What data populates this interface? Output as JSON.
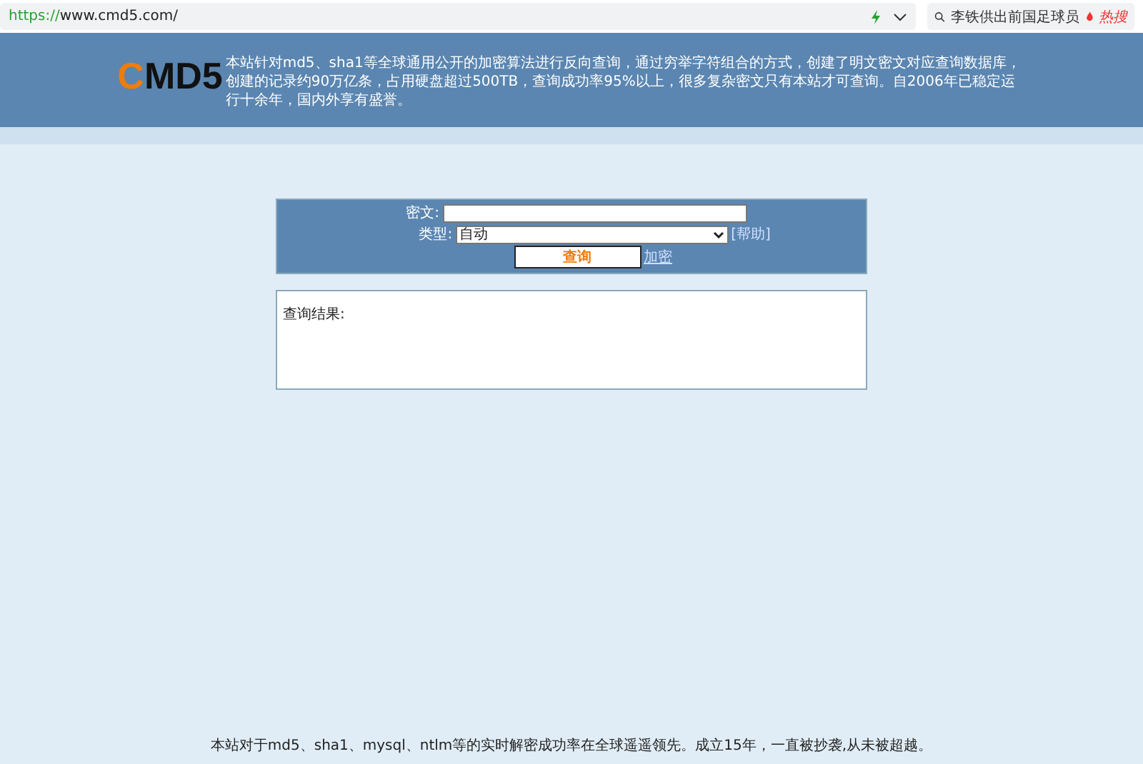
{
  "address_bar": {
    "scheme": "https://",
    "url": "www.cmd5.com/"
  },
  "hot_search": {
    "query": "李铁供出前国足球员",
    "badge": "热搜"
  },
  "header": {
    "logo_first": "C",
    "logo_rest": "MD5",
    "description": "本站针对md5、sha1等全球通用公开的加密算法进行反向查询，通过穷举字符组合的方式，创建了明文密文对应查询数据库，创建的记录约90万亿条，占用硬盘超过500TB，查询成功率95%以上，很多复杂密文只有本站才可查询。自2006年已稳定运行十余年，国内外享有盛誉。"
  },
  "form": {
    "cipher_label": "密文:",
    "type_label": "类型:",
    "type_value": "自动",
    "help_link": "[帮助]",
    "query_button": "查询",
    "encrypt_link": "加密"
  },
  "result": {
    "label": "查询结果:"
  },
  "footer": "本站对于md5、sha1、mysql、ntlm等的实时解密成功率在全球遥遥领先。成立15年，一直被抄袭,从未被超越。"
}
